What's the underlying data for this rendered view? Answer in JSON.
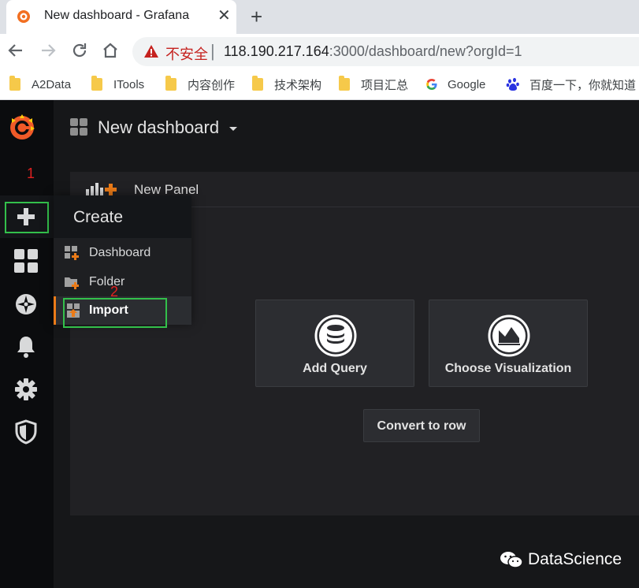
{
  "browser": {
    "tab_title": "New dashboard - Grafana",
    "tab_close": "✕",
    "new_tab": "+",
    "insecure_label": "不安全",
    "separator": "|",
    "url_host": "118.190.217.164",
    "url_rest": ":3000/dashboard/new?orgId=1",
    "bookmarks": [
      "A2Data",
      "ITools",
      "内容创作",
      "技术架构",
      "项目汇总",
      "Google",
      "百度一下，你就知道"
    ]
  },
  "annotations": {
    "step1": "1",
    "step2": "2"
  },
  "create_menu": {
    "title": "Create",
    "items": [
      "Dashboard",
      "Folder",
      "Import"
    ],
    "active_item": "Import"
  },
  "dashboard": {
    "title": "New dashboard"
  },
  "panel": {
    "title": "New Panel",
    "add_query": "Add Query",
    "choose_visualization": "Choose Visualization",
    "convert_to_row": "Convert to row"
  },
  "watermark": "DataScience",
  "colors": {
    "grafana_orange": "#eb7b18",
    "highlight_green": "#33c04b",
    "annotation_red": "#e02020"
  }
}
